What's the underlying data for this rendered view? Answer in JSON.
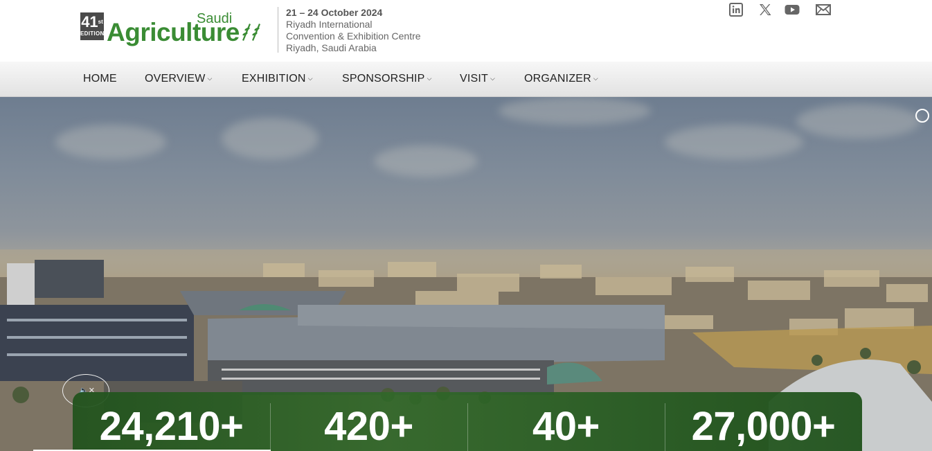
{
  "header": {
    "logo": {
      "edition_number": "41",
      "edition_suffix": "st",
      "edition_label": "EDITION",
      "brand_top": "Saudi",
      "brand_main": "Agriculture"
    },
    "event": {
      "date": "21 – 24 October 2024",
      "venue_line1": "Riyadh International",
      "venue_line2": "Convention & Exhibition Centre",
      "venue_line3": "Riyadh, Saudi Arabia"
    },
    "social": [
      {
        "name": "linkedin-icon"
      },
      {
        "name": "x-twitter-icon"
      },
      {
        "name": "youtube-icon"
      },
      {
        "name": "email-icon"
      }
    ]
  },
  "nav": {
    "items": [
      {
        "label": "HOME",
        "dropdown": false
      },
      {
        "label": "OVERVIEW",
        "dropdown": true
      },
      {
        "label": "EXHIBITION",
        "dropdown": true
      },
      {
        "label": "SPONSORSHIP",
        "dropdown": true
      },
      {
        "label": "VISIT",
        "dropdown": true
      },
      {
        "label": "ORGANIZER",
        "dropdown": true
      }
    ]
  },
  "stats": [
    {
      "value": "24,210+"
    },
    {
      "value": "420+"
    },
    {
      "value": "40+"
    },
    {
      "value": "27,000+"
    }
  ],
  "colors": {
    "brand_green": "#3a8c34",
    "stats_bg": "#2c6426"
  }
}
